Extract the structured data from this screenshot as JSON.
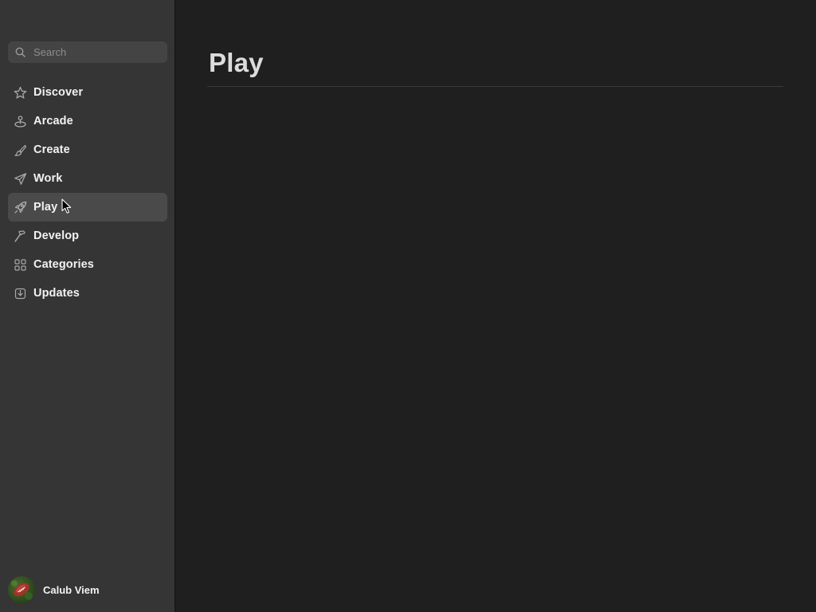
{
  "search": {
    "placeholder": "Search",
    "icon": "search-icon"
  },
  "sidebar": {
    "items": [
      {
        "label": "Discover",
        "icon": "star-icon",
        "active": false
      },
      {
        "label": "Arcade",
        "icon": "joystick-icon",
        "active": false
      },
      {
        "label": "Create",
        "icon": "brush-icon",
        "active": false
      },
      {
        "label": "Work",
        "icon": "paper-plane-icon",
        "active": false
      },
      {
        "label": "Play",
        "icon": "rocket-icon",
        "active": true
      },
      {
        "label": "Develop",
        "icon": "hammer-icon",
        "active": false
      },
      {
        "label": "Categories",
        "icon": "grid-icon",
        "active": false
      },
      {
        "label": "Updates",
        "icon": "download-tray-icon",
        "active": false
      }
    ]
  },
  "account": {
    "name": "Calub Viem",
    "avatar_icon": "football-avatar"
  },
  "main": {
    "title": "Play"
  },
  "colors": {
    "sidebar_bg": "#353535",
    "main_bg": "#1f1f1f",
    "active_item_bg": "#4a4a4a",
    "text": "#f2f2f2"
  }
}
